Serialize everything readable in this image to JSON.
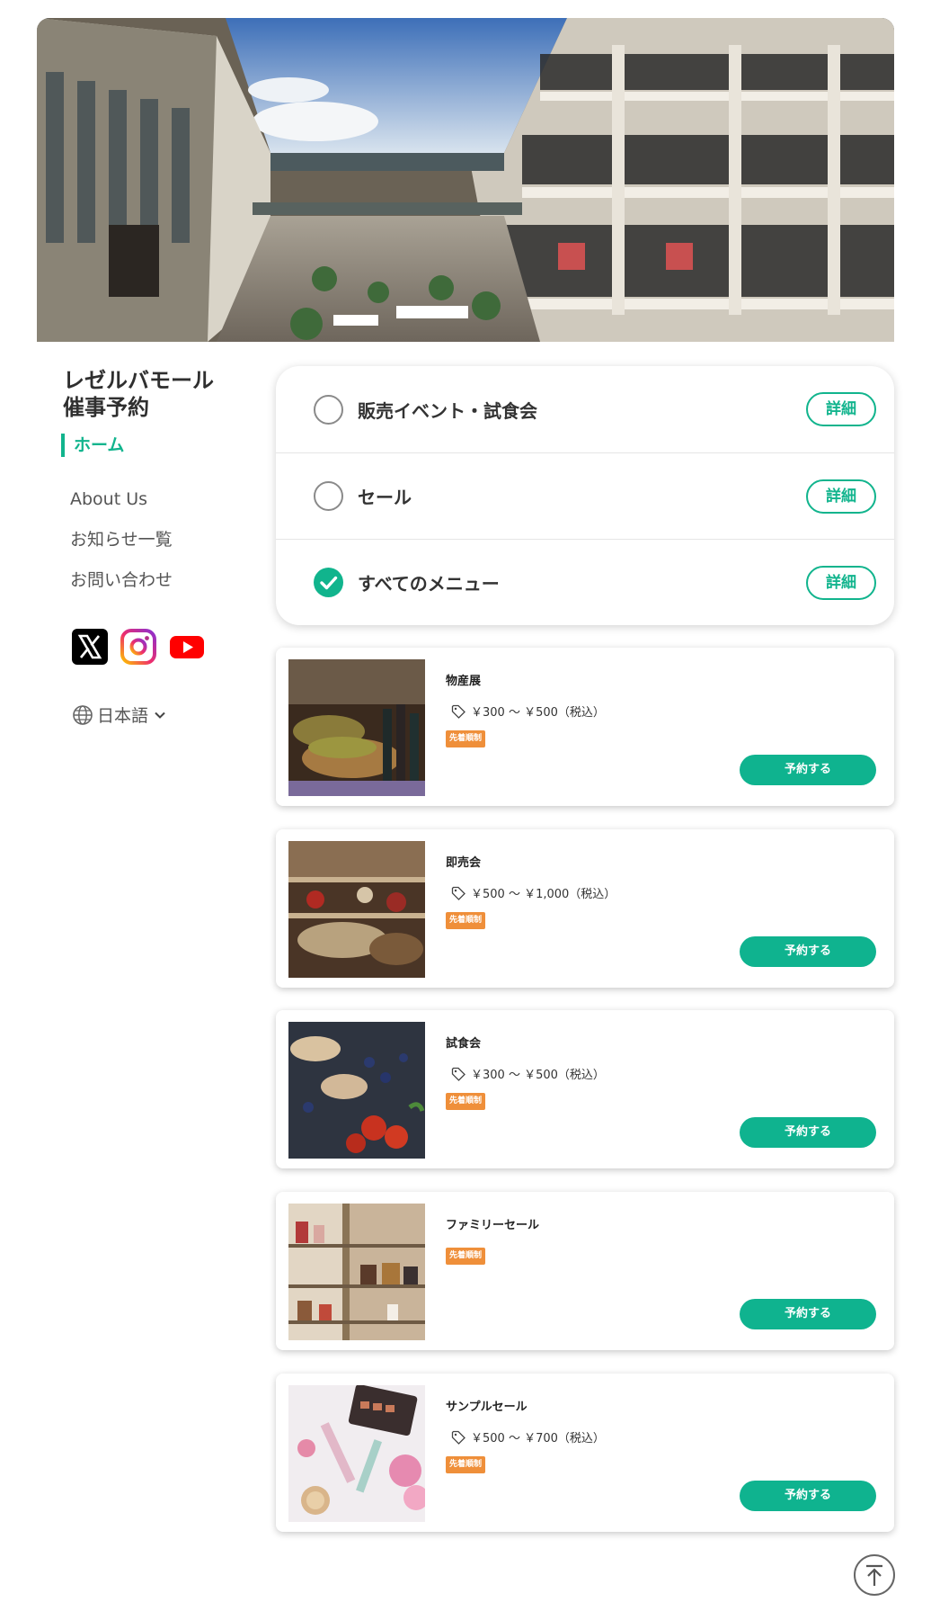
{
  "hero": {
    "image": "shopping-mall-atrium-photo"
  },
  "site": {
    "title_line1": "レゼルバモール",
    "title_line2": "催事予約"
  },
  "nav": {
    "home": "ホーム",
    "items": [
      {
        "label": "About Us"
      },
      {
        "label": "お知らせ一覧"
      },
      {
        "label": "お問い合わせ"
      }
    ]
  },
  "socials": [
    "x-icon",
    "instagram-icon",
    "youtube-icon"
  ],
  "language": {
    "label": "日本語"
  },
  "categories": [
    {
      "label": "販売イベント・試食会",
      "selected": false,
      "detail": "詳細"
    },
    {
      "label": "セール",
      "selected": false,
      "detail": "詳細"
    },
    {
      "label": "すべてのメニュー",
      "selected": true,
      "detail": "詳細"
    }
  ],
  "events": [
    {
      "title": "物産展",
      "price": "￥300 ～ ￥500（税込）",
      "badge": "先着順制",
      "button": "予約する"
    },
    {
      "title": "即売会",
      "price": "￥500 ～ ￥1,000（税込）",
      "badge": "先着順制",
      "button": "予約する"
    },
    {
      "title": "試食会",
      "price": "￥300 ～ ￥500（税込）",
      "badge": "先着順制",
      "button": "予約する"
    },
    {
      "title": "ファミリーセール",
      "price": null,
      "badge": "先着順制",
      "button": "予約する"
    },
    {
      "title": "サンプルセール",
      "price": "￥500 ～ ￥700（税込）",
      "badge": "先着順制",
      "button": "予約する"
    }
  ],
  "colors": {
    "accent": "#11b48d",
    "badge": "#ef8f3a",
    "text": "#333333"
  }
}
